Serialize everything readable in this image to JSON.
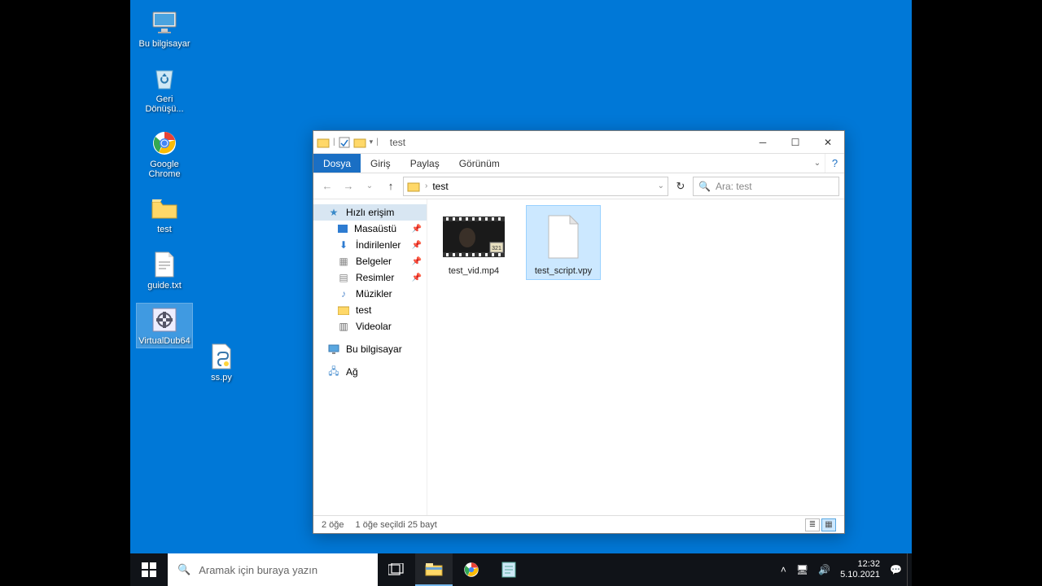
{
  "desktop_icons": {
    "computer": "Bu bilgisayar",
    "recycle": "Geri Dönüşü...",
    "chrome": "Google Chrome",
    "test_folder": "test",
    "guide": "guide.txt",
    "virtualdub": "VirtualDub64",
    "sspy": "ss.py"
  },
  "explorer": {
    "title": "test",
    "ribbon": {
      "file": "Dosya",
      "home": "Giriş",
      "share": "Paylaş",
      "view": "Görünüm"
    },
    "address": {
      "folder": "test"
    },
    "search_placeholder": "Ara: test",
    "nav": {
      "quick": "Hızlı erişim",
      "desktop": "Masaüstü",
      "downloads": "İndirilenler",
      "documents": "Belgeler",
      "pictures": "Resimler",
      "music": "Müzikler",
      "test": "test",
      "videos": "Videolar",
      "this_pc": "Bu bilgisayar",
      "network": "Ağ"
    },
    "files": {
      "video": "test_vid.mp4",
      "script": "test_script.vpy"
    },
    "status": {
      "count": "2 öğe",
      "selection": "1 öğe seçildi  25 bayt"
    }
  },
  "taskbar": {
    "search_placeholder": "Aramak için buraya yazın",
    "time": "12:32",
    "date": "5.10.2021"
  }
}
